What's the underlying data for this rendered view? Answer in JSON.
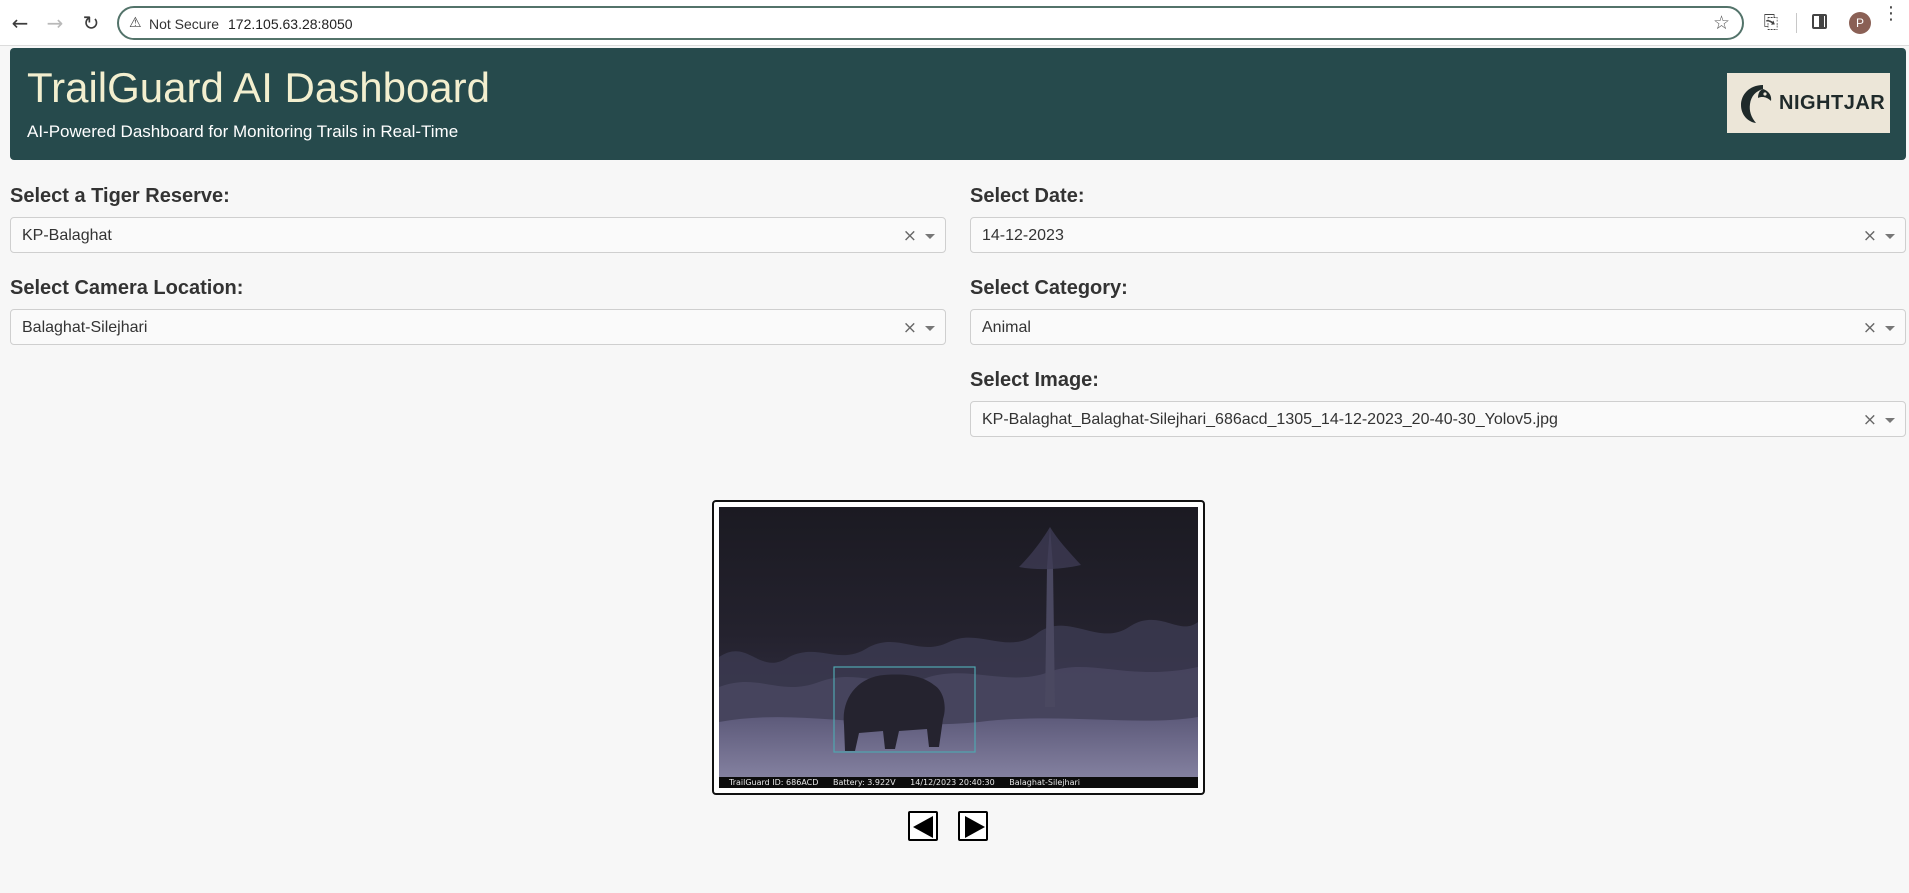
{
  "browser": {
    "security_label": "Not Secure",
    "url": "172.105.63.28:8050",
    "profile_initial": "P"
  },
  "header": {
    "title": "TrailGuard AI Dashboard",
    "subtitle": "AI-Powered Dashboard for Monitoring Trails in Real-Time",
    "logo_text": "NIGHTJAR",
    "background_color": "#264a4c",
    "title_color": "#f3efcf"
  },
  "filters": {
    "reserve": {
      "label": "Select a Tiger Reserve:",
      "value": "KP-Balaghat"
    },
    "date": {
      "label": "Select Date:",
      "value": "14-12-2023"
    },
    "camera": {
      "label": "Select Camera Location:",
      "value": "Balaghat-Silejhari"
    },
    "category": {
      "label": "Select Category:",
      "value": "Animal"
    },
    "image": {
      "label": "Select Image:",
      "value": "KP-Balaghat_Balaghat-Silejhari_686acd_1305_14-12-2023_20-40-30_Yolov5.jpg"
    }
  },
  "viewer": {
    "caption": {
      "trailguard_id": "TrailGuard ID: 686ACD",
      "battery": "Battery: 3.922V",
      "timestamp": "14/12/2023 20:40:30",
      "location": "Balaghat-Silejhari"
    },
    "detection_box_color": "#4fa6b0"
  },
  "icons": {
    "back": "back-arrow-icon",
    "forward": "forward-arrow-icon",
    "reload": "reload-icon",
    "warning": "warning-icon",
    "bookmark": "star-icon",
    "extensions": "puzzle-icon",
    "side_panel": "side-panel-icon",
    "menu": "kebab-menu-icon",
    "clear": "clear-x-icon",
    "dropdown": "chevron-down-icon",
    "prev": "prev-arrow-icon",
    "next": "next-arrow-icon"
  }
}
